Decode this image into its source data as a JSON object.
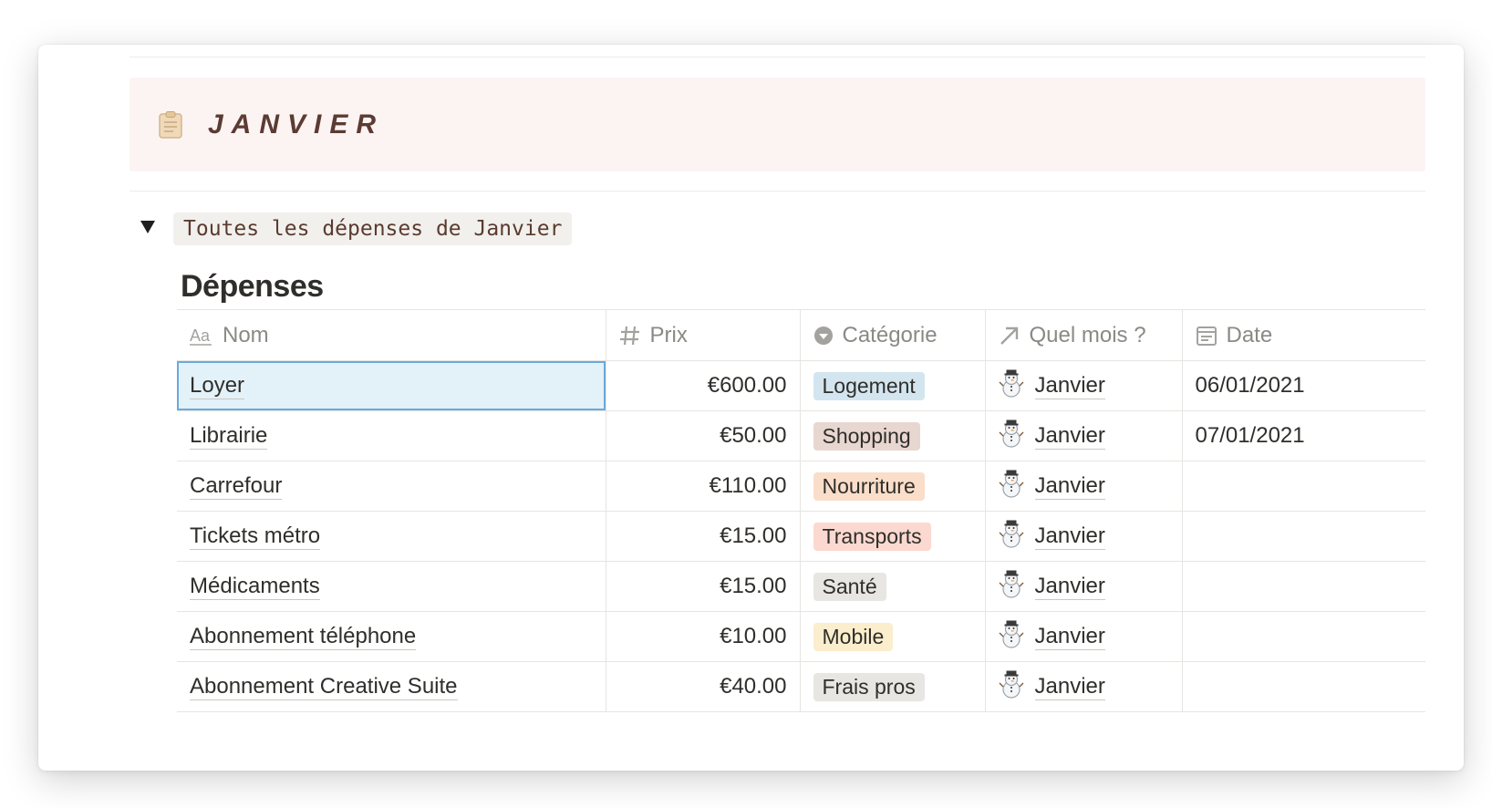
{
  "callout": {
    "title": "JANVIER",
    "icon": "clipboard-icon"
  },
  "toggle": {
    "label": "Toutes les dépenses de Janvier"
  },
  "database": {
    "title": "Dépenses",
    "columns": [
      {
        "label": "Nom",
        "icon": "text-icon"
      },
      {
        "label": "Prix",
        "icon": "hash-icon"
      },
      {
        "label": "Catégorie",
        "icon": "select-icon"
      },
      {
        "label": "Quel mois ?",
        "icon": "relation-arrow-icon"
      },
      {
        "label": "Date",
        "icon": "calendar-icon"
      }
    ],
    "rows": [
      {
        "nom": "Loyer",
        "prix": "€600.00",
        "categorie": "Logement",
        "cat_color": "#d3e5ef",
        "mois": "Janvier",
        "date": "06/01/2021"
      },
      {
        "nom": "Librairie",
        "prix": "€50.00",
        "categorie": "Shopping",
        "cat_color": "#e8d6d0",
        "mois": "Janvier",
        "date": "07/01/2021"
      },
      {
        "nom": "Carrefour",
        "prix": "€110.00",
        "categorie": "Nourriture",
        "cat_color": "#fadec9",
        "mois": "Janvier",
        "date": ""
      },
      {
        "nom": "Tickets métro",
        "prix": "€15.00",
        "categorie": "Transports",
        "cat_color": "#fbd9d0",
        "mois": "Janvier",
        "date": ""
      },
      {
        "nom": "Médicaments",
        "prix": "€15.00",
        "categorie": "Santé",
        "cat_color": "#e7e6e3",
        "mois": "Janvier",
        "date": ""
      },
      {
        "nom": "Abonnement téléphone",
        "prix": "€10.00",
        "categorie": "Mobile",
        "cat_color": "#fbeecd",
        "mois": "Janvier",
        "date": ""
      },
      {
        "nom": "Abonnement Creative Suite",
        "prix": "€40.00",
        "categorie": "Frais pros",
        "cat_color": "#e7e6e3",
        "mois": "Janvier",
        "date": ""
      }
    ]
  }
}
